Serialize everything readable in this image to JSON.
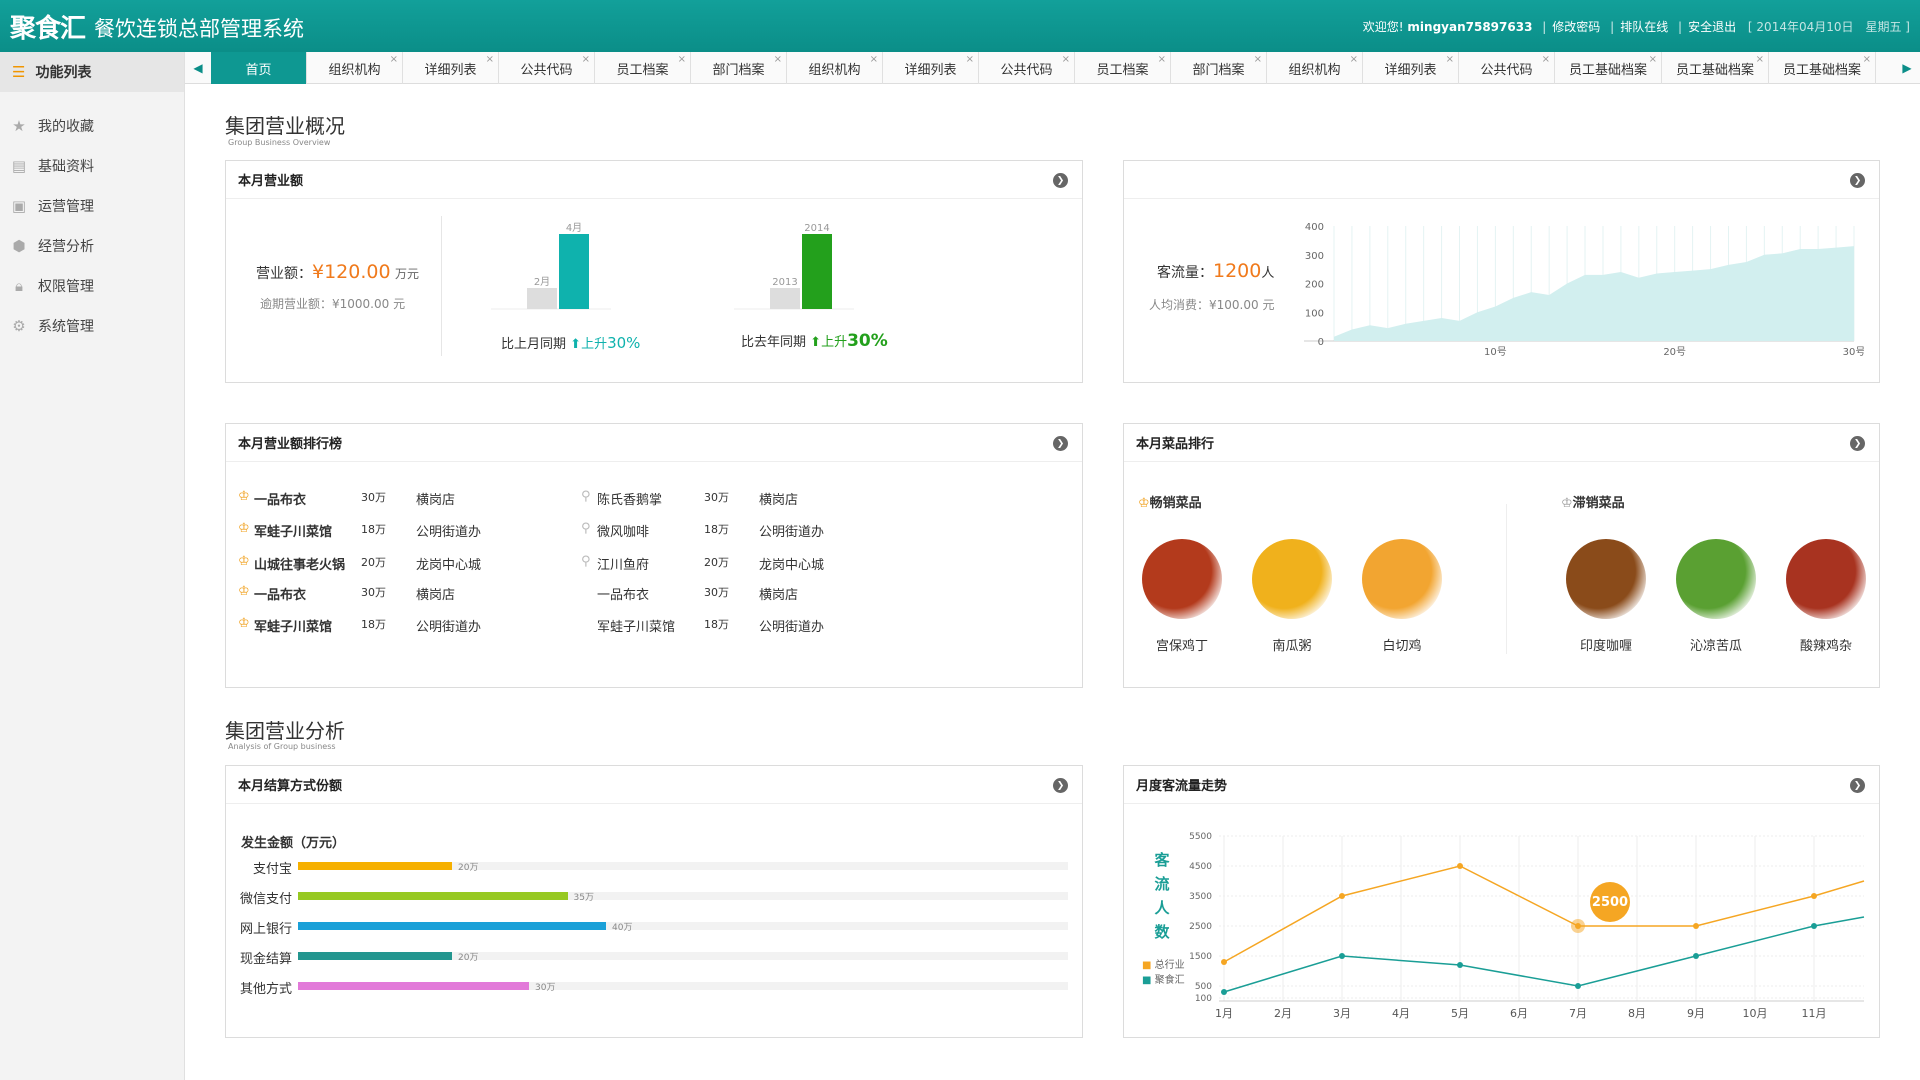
{
  "header": {
    "logo": "聚食汇",
    "title": "餐饮连锁总部管理系统",
    "welcome": "欢迎您!",
    "username": "mingyan75897633",
    "change_pwd": "修改密码",
    "queue": "排队在线",
    "logout": "安全退出",
    "date": "[ 2014年04月10日　星期五 ]"
  },
  "sidebar": {
    "title": "功能列表",
    "items": [
      {
        "label": "我的收藏",
        "icon": "star-icon"
      },
      {
        "label": "基础资料",
        "icon": "document-icon"
      },
      {
        "label": "运营管理",
        "icon": "book-icon"
      },
      {
        "label": "经营分析",
        "icon": "cube-icon"
      },
      {
        "label": "权限管理",
        "icon": "lock-icon"
      },
      {
        "label": "系统管理",
        "icon": "gear-icon"
      }
    ]
  },
  "tabs": [
    "首页",
    "组织机构",
    "详细列表",
    "公共代码",
    "员工档案",
    "部门档案",
    "组织机构",
    "详细列表",
    "公共代码",
    "员工档案",
    "部门档案",
    "组织机构",
    "详细列表",
    "公共代码",
    "员工基础档案",
    "员工基础档案",
    "员工基础档案"
  ],
  "overview": {
    "title": "集团营业概况",
    "subtitle": "Group Business Overview"
  },
  "revenue": {
    "title": "本月营业额",
    "label": "营业额：",
    "value": "¥120.00",
    "unit": "万元",
    "overdue": "逾期营业额：¥1000.00 元",
    "mom": {
      "prev_label": "2月",
      "curr_label": "4月",
      "prev_ratio": 0.28,
      "curr_ratio": 1.0,
      "caption": "比上月同期",
      "trend": "上升",
      "pct": "30%",
      "color": "#0fb2ad"
    },
    "yoy": {
      "prev_label": "2013",
      "curr_label": "2014",
      "prev_ratio": 0.28,
      "curr_ratio": 1.0,
      "caption": "比去年同期",
      "trend": "上升",
      "pct": "30%",
      "color": "#23a01c"
    }
  },
  "traffic": {
    "label": "客流量：",
    "value": "1200",
    "unit": "人",
    "avg": "人均消费：¥100.00 元",
    "chart_data": {
      "type": "area",
      "x_ticks": [
        "10号",
        "20号",
        "30号"
      ],
      "y_ticks": [
        "400",
        "300",
        "200",
        "100",
        "0"
      ],
      "ylim": [
        0,
        400
      ],
      "x": [
        1,
        2,
        3,
        4,
        5,
        6,
        7,
        8,
        9,
        10,
        11,
        12,
        13,
        14,
        15,
        16,
        17,
        18,
        19,
        20,
        21,
        22,
        23,
        24,
        25,
        26,
        27,
        28,
        29,
        30
      ],
      "values": [
        15,
        40,
        55,
        45,
        60,
        70,
        80,
        70,
        100,
        120,
        150,
        170,
        160,
        200,
        230,
        230,
        240,
        220,
        235,
        240,
        245,
        250,
        265,
        275,
        300,
        305,
        320,
        320,
        325,
        330
      ]
    }
  },
  "rank": {
    "title": "本月营业额排行榜",
    "rows": [
      {
        "name": "一品布衣",
        "amount": "30万",
        "store": "横岗店"
      },
      {
        "name": "军蛙子川菜馆",
        "amount": "18万",
        "store": "公明街道办"
      },
      {
        "name": "山城往事老火锅",
        "amount": "20万",
        "store": "龙岗中心城"
      },
      {
        "name": "一品布衣",
        "amount": "30万",
        "store": "横岗店"
      },
      {
        "name": "军蛙子川菜馆",
        "amount": "18万",
        "store": "公明街道办"
      },
      {
        "name": "陈氏香鹅掌",
        "amount": "30万",
        "store": "横岗店"
      },
      {
        "name": "微风咖啡",
        "amount": "18万",
        "store": "公明街道办"
      },
      {
        "name": "江川鱼府",
        "amount": "20万",
        "store": "龙岗中心城"
      },
      {
        "name": "一品布衣",
        "amount": "30万",
        "store": "横岗店"
      },
      {
        "name": "军蛙子川菜馆",
        "amount": "18万",
        "store": "公明街道办"
      }
    ]
  },
  "dishes": {
    "title": "本月菜品排行",
    "best_label": "畅销菜品",
    "worst_label": "滞销菜品",
    "best": [
      {
        "name": "宫保鸡丁",
        "color": "#b33a1c"
      },
      {
        "name": "南瓜粥",
        "color": "#f0b11c"
      },
      {
        "name": "白切鸡",
        "color": "#f2a531"
      }
    ],
    "worst": [
      {
        "name": "印度咖喱",
        "color": "#8a4b1a"
      },
      {
        "name": "沁凉苦瓜",
        "color": "#5aa032"
      },
      {
        "name": "酸辣鸡杂",
        "color": "#a83320"
      }
    ]
  },
  "analysis": {
    "title": "集团营业分析",
    "subtitle": "Analysis of Group business"
  },
  "payment": {
    "title": "本月结算方式份额",
    "subtitle": "发生金额（万元）",
    "chart_data": {
      "type": "bar",
      "categories": [
        "支付宝",
        "微信支付",
        "网上银行",
        "现金结算",
        "其他方式"
      ],
      "values": [
        20,
        35,
        40,
        20,
        30
      ],
      "labels": [
        "20万",
        "35万",
        "40万",
        "20万",
        "30万"
      ],
      "colors": [
        "#f6b000",
        "#97c922",
        "#1aa0d8",
        "#23968f",
        "#e27ad9"
      ],
      "xlim": [
        0,
        100
      ]
    }
  },
  "monthly": {
    "title": "月度客流量走势",
    "ylabel": "客流人数",
    "tooltip": "2500",
    "chart_data": {
      "type": "line",
      "x": [
        "1月",
        "2月",
        "3月",
        "4月",
        "5月",
        "6月",
        "7月",
        "8月",
        "9月",
        "10月",
        "11月"
      ],
      "y_ticks": [
        "5500",
        "4500",
        "3500",
        "2500",
        "1500",
        "500",
        "100"
      ],
      "series": [
        {
          "name": "总行业",
          "color": "#f5a623",
          "values": [
            1300,
            null,
            3500,
            null,
            4500,
            null,
            2500,
            null,
            2500,
            null,
            3500
          ]
        },
        {
          "name": "聚食汇",
          "color": "#1a9e96",
          "values": [
            300,
            null,
            1500,
            null,
            1200,
            null,
            500,
            null,
            1500,
            null,
            2500
          ]
        }
      ]
    }
  }
}
